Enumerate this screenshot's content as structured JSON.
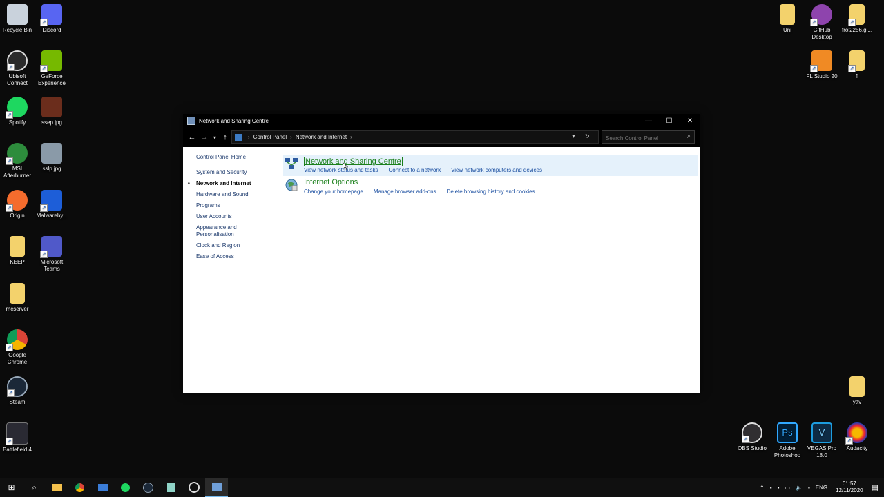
{
  "desktop": {
    "left_icons": [
      {
        "label": "Recycle Bin",
        "icon": "recycle-bin-icon",
        "color": "#c9d2dc"
      },
      {
        "label": "Discord",
        "icon": "discord-icon",
        "color": "#5865f2"
      },
      {
        "label": "Ubisoft Connect",
        "icon": "ubisoft-icon",
        "color": "#2b2b2b"
      },
      {
        "label": "GeForce Experience",
        "icon": "geforce-icon",
        "color": "#76b900"
      },
      {
        "label": "Spotify",
        "icon": "spotify-icon",
        "color": "#1ed760"
      },
      {
        "label": "ssep.jpg",
        "icon": "image-file-icon",
        "color": "#6b2d1c"
      },
      {
        "label": "MSI Afterburner",
        "icon": "msi-afterburner-icon",
        "color": "#2d8c3c"
      },
      {
        "label": "sslp.jpg",
        "icon": "image-file-icon",
        "color": "#8a9aa8"
      },
      {
        "label": "Origin",
        "icon": "origin-icon",
        "color": "#f56c2d"
      },
      {
        "label": "Malwareby...",
        "icon": "malwarebytes-icon",
        "color": "#1d5ed8"
      },
      {
        "label": "KEEP",
        "icon": "folder-icon",
        "color": "#f3d26c"
      },
      {
        "label": "Microsoft Teams",
        "icon": "teams-icon",
        "color": "#5059c9"
      },
      {
        "label": "mcserver",
        "icon": "folder-icon",
        "color": "#f3d26c"
      },
      {
        "label": "Google Chrome",
        "icon": "chrome-icon",
        "color": "#db4437"
      },
      {
        "label": "Steam",
        "icon": "steam-icon",
        "color": "#1b2838"
      },
      {
        "label": "Battlefield 4",
        "icon": "battlefield-icon",
        "color": "#2a2a33"
      }
    ],
    "right_icons": [
      {
        "label": "Uni",
        "icon": "folder-icon",
        "color": "#f3d26c"
      },
      {
        "label": "GitHub Desktop",
        "icon": "github-desktop-icon",
        "color": "#8e44ad"
      },
      {
        "label": "frol2256.gi...",
        "icon": "zip-folder-icon",
        "color": "#f3d26c"
      },
      {
        "label": "FL Studio 20",
        "icon": "fl-studio-icon",
        "color": "#f08a24"
      },
      {
        "label": "fl",
        "icon": "folder-icon",
        "color": "#f3d26c"
      },
      {
        "label": "yttv",
        "icon": "zip-folder-icon",
        "color": "#f3d26c"
      },
      {
        "label": "OBS Studio",
        "icon": "obs-icon",
        "color": "#302e31"
      },
      {
        "label": "Adobe Photoshop",
        "icon": "photoshop-icon",
        "color": "#31a8ff"
      },
      {
        "label": "VEGAS Pro 18.0",
        "icon": "vegas-pro-icon",
        "color": "#1d6fa5"
      },
      {
        "label": "Audacity",
        "icon": "audacity-icon",
        "color": "#f5b800"
      }
    ]
  },
  "window": {
    "title": "Network and Sharing Centre",
    "controls": {
      "minimize": "—",
      "maximize": "☐",
      "close": "✕"
    },
    "address": {
      "crumbs": [
        "Control Panel",
        "Network and Internet"
      ]
    },
    "search_placeholder": "Search Control Panel",
    "nav": {
      "home": "Control Panel Home",
      "items": [
        "System and Security",
        "Network and Internet",
        "Hardware and Sound",
        "Programs",
        "User Accounts",
        "Appearance and Personalisation",
        "Clock and Region",
        "Ease of Access"
      ]
    },
    "sections": [
      {
        "title": "Network and Sharing Centre",
        "links": [
          "View network status and tasks",
          "Connect to a network",
          "View network computers and devices"
        ]
      },
      {
        "title": "Internet Options",
        "links": [
          "Change your homepage",
          "Manage browser add-ons",
          "Delete browsing history and cookies"
        ]
      }
    ]
  },
  "taskbar": {
    "apps": [
      "windows-start-icon",
      "search-icon",
      "file-explorer-icon",
      "chrome-icon",
      "mail-icon",
      "spotify-icon",
      "steam-icon",
      "notepad-icon",
      "obs-icon",
      "control-panel-icon"
    ],
    "tray": {
      "language": "ENG",
      "time": "01:57",
      "date": "12/11/2020"
    }
  }
}
